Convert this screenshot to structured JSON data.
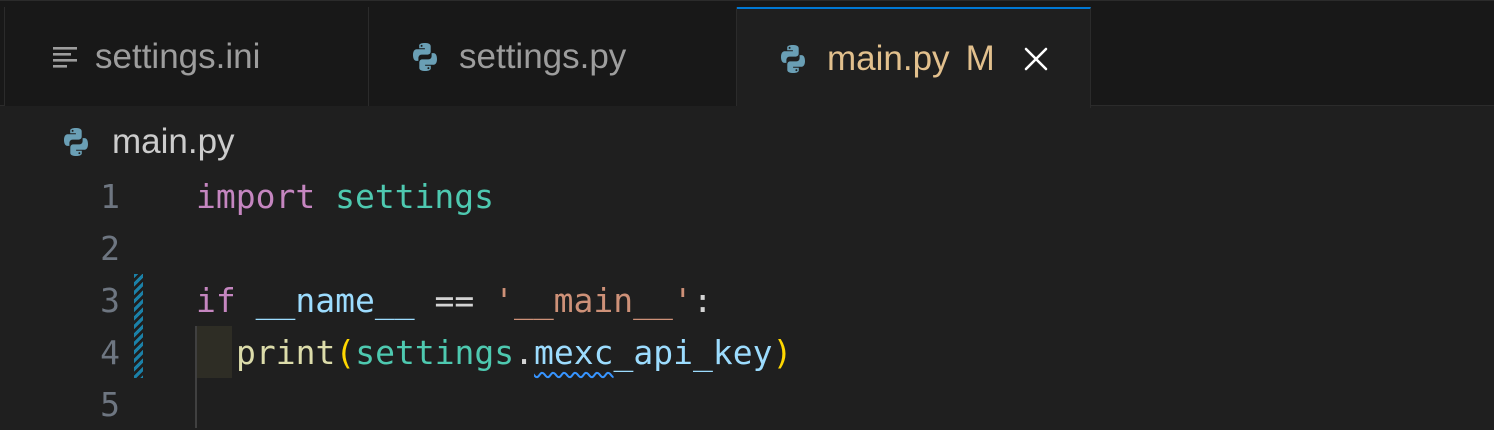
{
  "tabs": [
    {
      "label": "settings.ini",
      "icon": "lines-icon",
      "active": false
    },
    {
      "label": "settings.py",
      "icon": "python-icon",
      "active": false
    },
    {
      "label": "main.py",
      "icon": "python-icon",
      "active": true,
      "badge": "M"
    }
  ],
  "breadcrumb": {
    "label": "main.py",
    "icon": "python-icon"
  },
  "code_lines": [
    {
      "number": "1"
    },
    {
      "number": "2"
    },
    {
      "number": "3"
    },
    {
      "number": "4"
    },
    {
      "number": "5"
    }
  ],
  "tokens": {
    "l1_import": "import",
    "l1_module": "settings",
    "l3_if": "if",
    "l3_name": "__name__",
    "l3_op": "==",
    "l3_str": "'__main__'",
    "l3_colon": ":",
    "l4_print": "print",
    "l4_open": "(",
    "l4_module": "settings",
    "l4_dot": ".",
    "l4_attr_a": "mexc",
    "l4_attr_b": "_api_key",
    "l4_close": ")"
  },
  "colors": {
    "accent": "#0078d4",
    "modified": "#e2c08d",
    "keyword": "#c586c0",
    "module": "#4ec9b0",
    "variable": "#9cdcfe",
    "string": "#ce9178",
    "function": "#dcdcaa",
    "bracket": "#ffd700"
  }
}
